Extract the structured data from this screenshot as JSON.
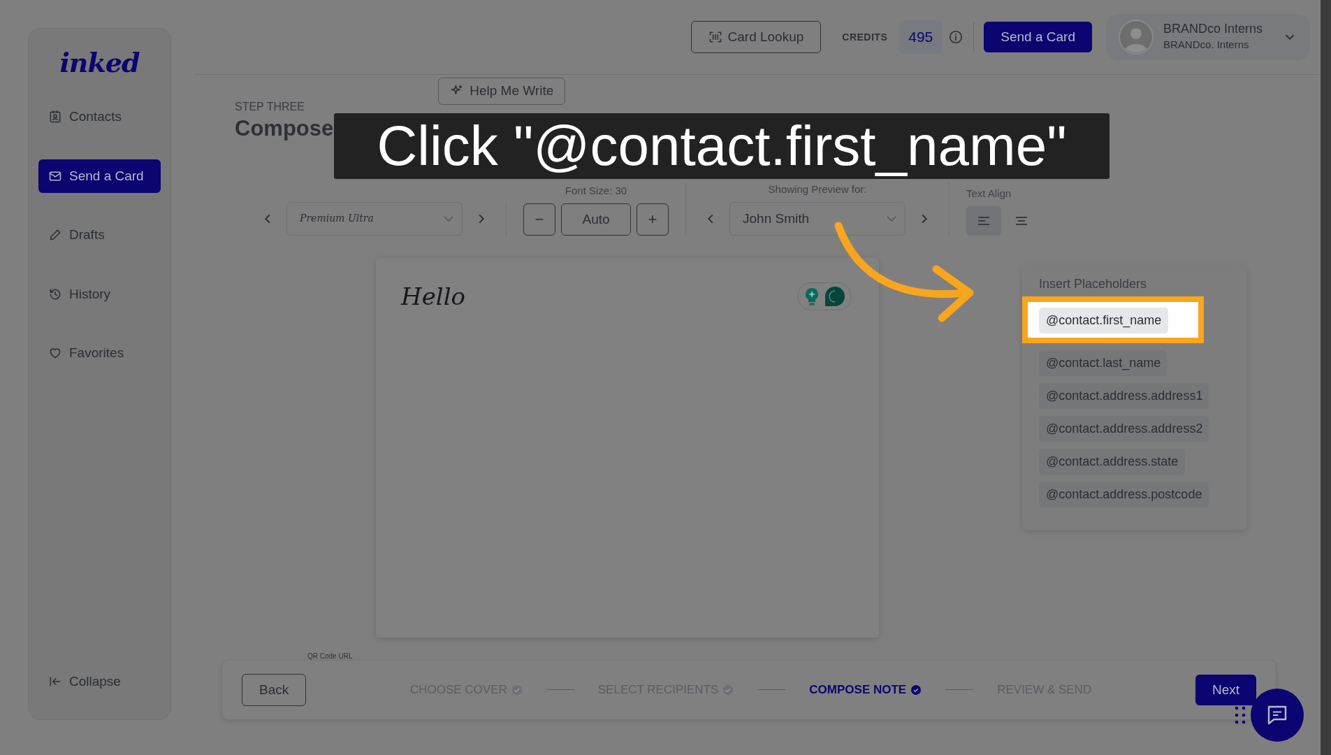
{
  "sidebar": {
    "logo": "inked",
    "items": [
      {
        "label": "Contacts",
        "selected": false
      },
      {
        "label": "Send a Card",
        "selected": true
      },
      {
        "label": "Drafts",
        "selected": false
      },
      {
        "label": "History",
        "selected": false
      },
      {
        "label": "Favorites",
        "selected": false
      }
    ],
    "collapse": "Collapse"
  },
  "header": {
    "card_lookup": "Card Lookup",
    "credits_label": "CREDITS",
    "credits": "495",
    "send_button": "Send a Card",
    "user": {
      "name": "BRANDco Interns",
      "org": "BRANDco. Interns"
    }
  },
  "step": {
    "label": "STEP THREE",
    "title": "Compose",
    "help_button": "Help Me Write"
  },
  "toolbar": {
    "font": "Premium Ultra",
    "font_size_label": "Font Size: 30",
    "minus": "−",
    "size_value": "Auto",
    "plus": "+",
    "preview_label": "Showing Preview for:",
    "preview_contact": "John Smith",
    "align_label": "Text Align",
    "align": [
      {
        "selected": true
      },
      {
        "selected": false
      }
    ]
  },
  "note": {
    "text": "Hello",
    "qr_label": "QR Code URL",
    "assistant_on": true
  },
  "placeholders": {
    "title": "Insert Placeholders",
    "items": [
      {
        "label": "@contact.first_name",
        "highlighted": true
      },
      {
        "label": "@contact.last_name",
        "highlighted": false
      },
      {
        "label": "@contact.address.address1",
        "highlighted": false
      },
      {
        "label": "@contact.address.address2",
        "highlighted": false
      },
      {
        "label": "@contact.address.state",
        "highlighted": false
      },
      {
        "label": "@contact.address.postcode",
        "highlighted": false
      }
    ]
  },
  "progress": {
    "back": "Back",
    "steps": [
      {
        "label": "CHOOSE COVER",
        "completed": true,
        "selected": false
      },
      {
        "label": "SELECT RECIPIENTS",
        "completed": true,
        "selected": false
      },
      {
        "label": "COMPOSE NOTE",
        "completed": true,
        "selected": true
      },
      {
        "label": "REVIEW & SEND",
        "completed": false,
        "selected": false
      }
    ],
    "next": "Next"
  },
  "tutorial": {
    "caption": "Click \"@contact.first_name\""
  }
}
